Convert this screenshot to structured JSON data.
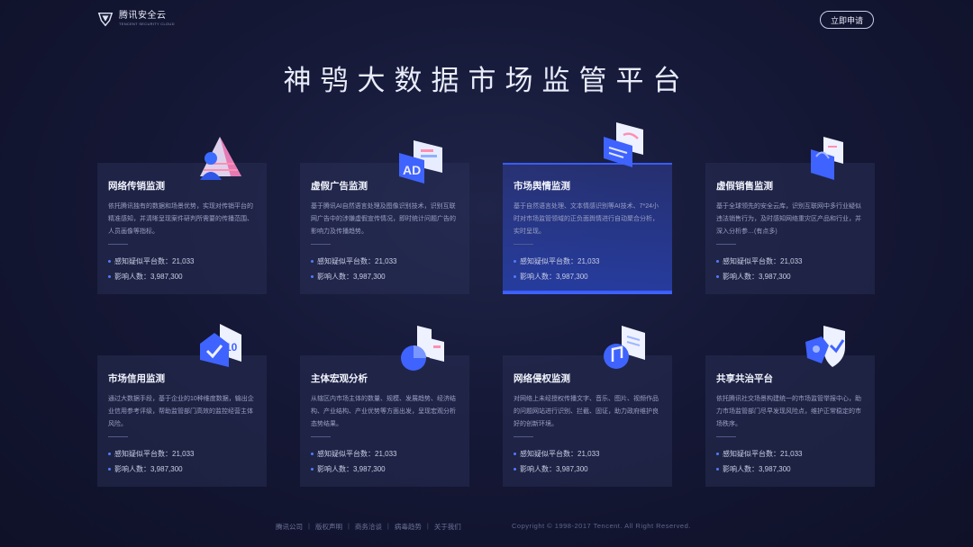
{
  "header": {
    "logo_text": "腾讯安全云",
    "logo_sub": "TENCENT SECURITY CLOUD",
    "apply_label": "立即申请"
  },
  "title": "神鸮大数据市场监管平台",
  "cards": [
    {
      "title": "网络传销监测",
      "desc": "依托腾讯独有的数据和场景优势，实现对传销平台的精准感知，并清晰呈现案件研判所需要的传播范围、人员画像等指标。",
      "stat1": "感知疑似平台数：21,033",
      "stat2": "影响人数：3,987,300",
      "icon": "pyramid-person-icon"
    },
    {
      "title": "虚假广告监测",
      "desc": "基于腾讯AI自然语言处理及图像识别技术，识别互联网广告中的涉嫌虚假宣传情况，即时统计问题广告的影响力及传播趋势。",
      "stat1": "感知疑似平台数：21,033",
      "stat2": "影响人数：3,987,300",
      "icon": "ad-screen-icon"
    },
    {
      "title": "市场舆情监测",
      "desc": "基于自然语言处理、文本情感识别等AI技术、7*24小时对市场监管领域的正负面舆情进行自动聚合分析，实时呈现。",
      "stat1": "感知疑似平台数：21,033",
      "stat2": "影响人数：3,987,300",
      "icon": "chat-bubble-icon"
    },
    {
      "title": "虚假销售监测",
      "desc": "基于全球领先的安全云库，识别互联网中多行业疑似违法销售行为，及时感知网络重灾区产品和行业，并深入分析参…(有点多)",
      "stat1": "感知疑似平台数：21,033",
      "stat2": "影响人数：3,987,300",
      "icon": "shopping-bag-icon"
    },
    {
      "title": "市场信用监测",
      "desc": "通过大数据手段，基于企业的10种维度数据，输出企业信用参考评级，帮助监管部门高效的监控经营主体风险。",
      "stat1": "感知疑似平台数：21,033",
      "stat2": "影响人数：3,987,300",
      "icon": "credit-house-icon"
    },
    {
      "title": "主体宏观分析",
      "desc": "从辖区内市场主体的数量、规模、发展趋势、经济结构、产业结构、产业优势等方面出发，呈现宏观分析态势结果。",
      "stat1": "感知疑似平台数：21,033",
      "stat2": "影响人数：3,987,300",
      "icon": "pie-chart-icon"
    },
    {
      "title": "网络侵权监测",
      "desc": "对网络上未经授权传播文字、音乐、图片、视频作品的问题网站进行识别、拦截、固证，助力政府维护良好的创新环境。",
      "stat1": "感知疑似平台数：21,033",
      "stat2": "影响人数：3,987,300",
      "icon": "music-file-icon"
    },
    {
      "title": "共享共治平台",
      "desc": "依托腾讯社交场景构建统一的市场监管举报中心，助力市场监管部门尽早发现风险点，维护正常稳定的市场秩序。",
      "stat1": "感知疑似平台数：21,033",
      "stat2": "影响人数：3,987,300",
      "icon": "shield-handshake-icon"
    }
  ],
  "footer": {
    "links": [
      "腾讯公司",
      "版权声明",
      "商务洽谈",
      "病毒趋势",
      "关于我们"
    ],
    "separator": "|",
    "copyright": "Copyright © 1998-2017 Tencent. All Right Reserved."
  },
  "colors": {
    "accent": "#3f63ff",
    "card_bg": "#2c325c",
    "background": "#151836"
  }
}
